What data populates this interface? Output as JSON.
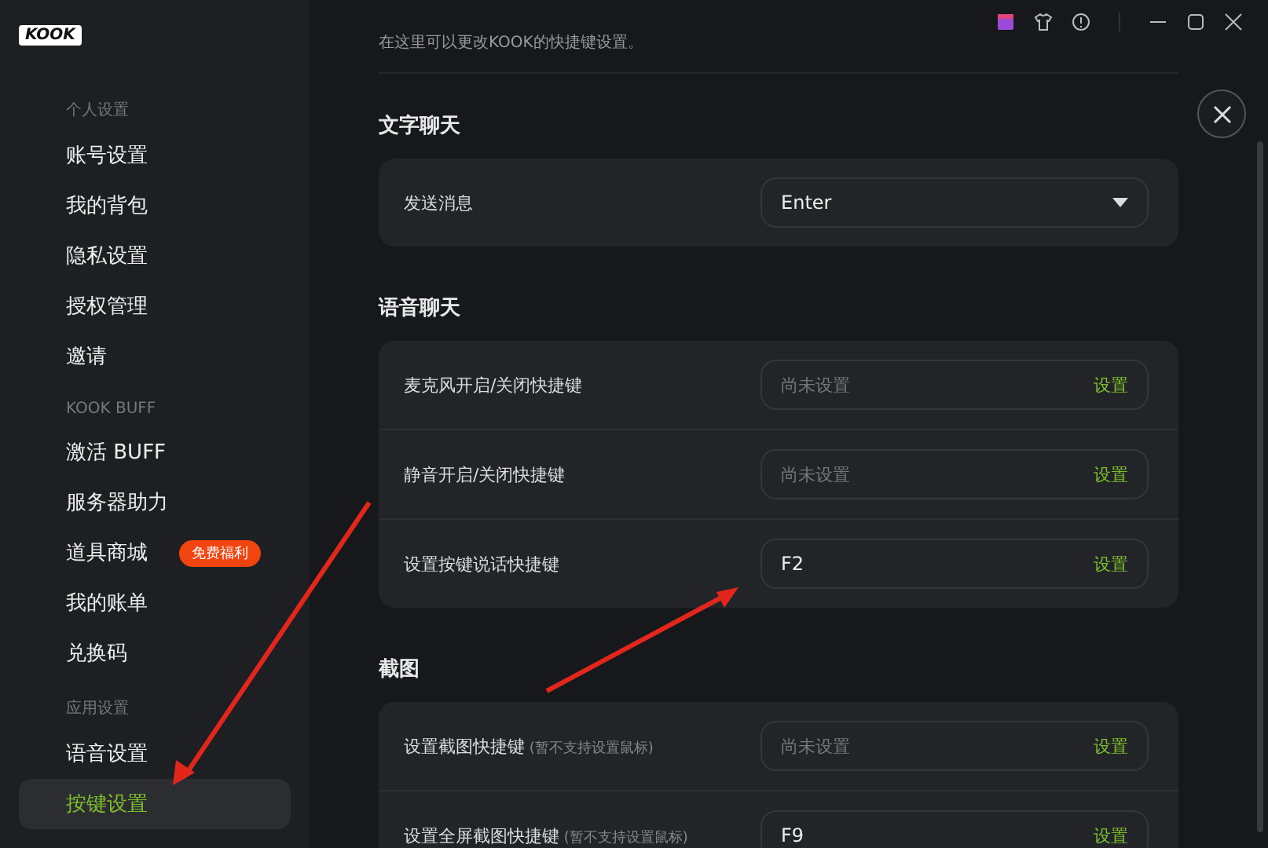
{
  "logo": "KOOK",
  "sidebar": {
    "groups": [
      {
        "label": "个人设置",
        "items": [
          {
            "label": "账号设置",
            "selected": false
          },
          {
            "label": "我的背包",
            "selected": false
          },
          {
            "label": "隐私设置",
            "selected": false
          },
          {
            "label": "授权管理",
            "selected": false
          },
          {
            "label": "邀请",
            "selected": false
          }
        ]
      },
      {
        "label": "KOOK BUFF",
        "items": [
          {
            "label": "激活 BUFF",
            "selected": false
          },
          {
            "label": "服务器助力",
            "selected": false
          },
          {
            "label": "道具商城",
            "selected": false,
            "badge": "免费福利"
          },
          {
            "label": "我的账单",
            "selected": false
          },
          {
            "label": "兑换码",
            "selected": false
          }
        ]
      },
      {
        "label": "应用设置",
        "items": [
          {
            "label": "语音设置",
            "selected": false
          },
          {
            "label": "按键设置",
            "selected": true
          }
        ]
      }
    ]
  },
  "description": "在这里可以更改KOOK的快捷键设置。",
  "sections": [
    {
      "title": "文字聊天",
      "rows": [
        {
          "kind": "select",
          "label": "发送消息",
          "value": "Enter"
        }
      ]
    },
    {
      "title": "语音聊天",
      "rows": [
        {
          "kind": "shortcut",
          "label": "麦克风开启/关闭快捷键",
          "placeholder": "尚未设置",
          "action": "设置"
        },
        {
          "kind": "shortcut",
          "label": "静音开启/关闭快捷键",
          "placeholder": "尚未设置",
          "action": "设置"
        },
        {
          "kind": "shortcut",
          "label": "设置按键说话快捷键",
          "value": "F2",
          "action": "设置"
        }
      ]
    },
    {
      "title": "截图",
      "rows": [
        {
          "kind": "shortcut",
          "label": "设置截图快捷键",
          "note": "(暂不支持设置鼠标)",
          "placeholder": "尚未设置",
          "action": "设置"
        },
        {
          "kind": "shortcut",
          "label": "设置全屏截图快捷键",
          "note": "(暂不支持设置鼠标)",
          "value": "F9",
          "action": "设置"
        }
      ]
    }
  ]
}
